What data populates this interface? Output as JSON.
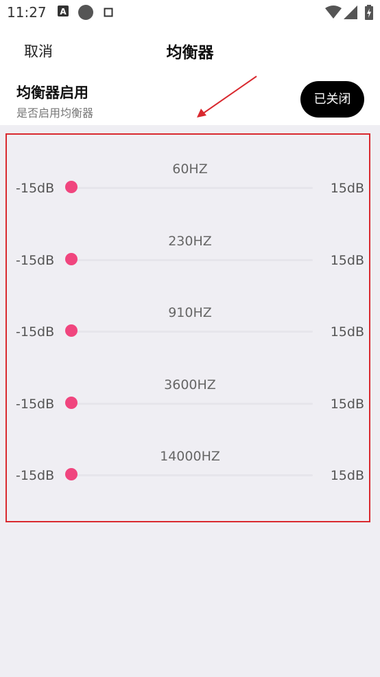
{
  "status_bar": {
    "time": "11:27",
    "icons": [
      "a-notification-icon",
      "circle-notification-icon",
      "square-notification-icon",
      "wifi-icon",
      "signal-icon",
      "battery-charging-icon"
    ]
  },
  "header": {
    "cancel_label": "取消",
    "title": "均衡器"
  },
  "equalizer_toggle": {
    "title": "均衡器启用",
    "subtitle": "是否启用均衡器",
    "button_label": "已关闭"
  },
  "bands": [
    {
      "freq": "60HZ",
      "min": "-15dB",
      "max": "15dB",
      "level_db": -15
    },
    {
      "freq": "230HZ",
      "min": "-15dB",
      "max": "15dB",
      "level_db": -15
    },
    {
      "freq": "910HZ",
      "min": "-15dB",
      "max": "15dB",
      "level_db": -15
    },
    {
      "freq": "3600HZ",
      "min": "-15dB",
      "max": "15dB",
      "level_db": -15
    },
    {
      "freq": "14000HZ",
      "min": "-15dB",
      "max": "15dB",
      "level_db": -15
    }
  ],
  "colors": {
    "accent": "#f0457e",
    "highlight_border": "#d9292f",
    "toggle_bg": "#000000"
  }
}
